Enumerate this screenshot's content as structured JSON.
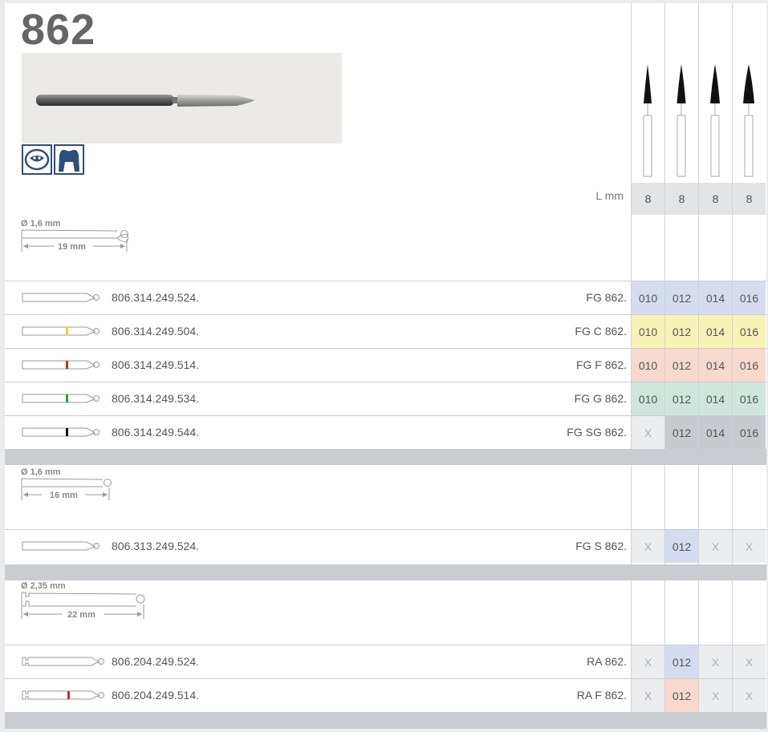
{
  "title": "862",
  "lengths": {
    "label": "L mm",
    "values": [
      "8",
      "8",
      "8",
      "8"
    ]
  },
  "groups": [
    {
      "diameter": "Ø 1,6 mm",
      "length": "19 mm",
      "rows": [
        {
          "code": "806.314.249.524.",
          "name": "FG 862.",
          "band": null,
          "cells": [
            "010",
            "012",
            "014",
            "016"
          ],
          "bg": [
            "#d5dcef",
            "#d5dcef",
            "#d5dcef",
            "#d5dcef"
          ]
        },
        {
          "code": "806.314.249.504.",
          "name": "FG C 862.",
          "band": "#e8d820",
          "cells": [
            "010",
            "012",
            "014",
            "016"
          ],
          "bg": [
            "#f7f3b5",
            "#f7f3b5",
            "#f7f3b5",
            "#f7f3b5"
          ]
        },
        {
          "code": "806.314.249.514.",
          "name": "FG F 862.",
          "band": "#d6262b",
          "cells": [
            "010",
            "012",
            "014",
            "016"
          ],
          "bg": [
            "#f8d9cd",
            "#f8d9cd",
            "#f8d9cd",
            "#f8d9cd"
          ]
        },
        {
          "code": "806.314.249.534.",
          "name": "FG G 862.",
          "band": "#27a243",
          "cells": [
            "010",
            "012",
            "014",
            "016"
          ],
          "bg": [
            "#cde7dc",
            "#cde7dc",
            "#cde7dc",
            "#cde7dc"
          ]
        },
        {
          "code": "806.314.249.544.",
          "name": "FG SG 862.",
          "band": "#111111",
          "cells": [
            "X",
            "012",
            "014",
            "016"
          ],
          "bg": [
            "#ecedef",
            "#c7cacf",
            "#c7cacf",
            "#c7cacf"
          ]
        }
      ]
    },
    {
      "diameter": "Ø 1,6 mm",
      "length": "16 mm",
      "rows": [
        {
          "code": "806.313.249.524.",
          "name": "FG S 862.",
          "band": null,
          "cells": [
            "X",
            "012",
            "X",
            "X"
          ],
          "bg": [
            "#ecedef",
            "#d5dcef",
            "#ecedef",
            "#ecedef"
          ]
        }
      ]
    },
    {
      "diameter": "Ø 2,35 mm",
      "length": "22 mm",
      "rows": [
        {
          "code": "806.204.249.524.",
          "name": "RA 862.",
          "band": null,
          "cells": [
            "X",
            "012",
            "X",
            "X"
          ],
          "bg": [
            "#ecedef",
            "#d5dcef",
            "#ecedef",
            "#ecedef"
          ]
        },
        {
          "code": "806.204.249.514.",
          "name": "RA F 862.",
          "band": "#d6262b",
          "cells": [
            "X",
            "012",
            "X",
            "X"
          ],
          "bg": [
            "#ecedef",
            "#f8d9cd",
            "#ecedef",
            "#ecedef"
          ]
        }
      ]
    }
  ],
  "icons": [
    "patient-mouth-icon",
    "tooth-crown-icon"
  ]
}
